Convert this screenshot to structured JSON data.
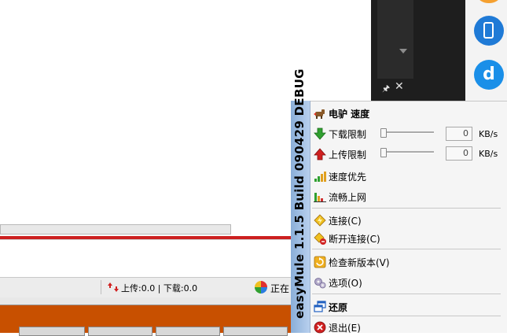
{
  "background": {
    "status_updown_text": "上传:0.0 | 下载:0.0",
    "status_now_text": "正在"
  },
  "banner": {
    "text": "easyMule 1.1.5 Build 090429 DEBUG"
  },
  "menu": {
    "items": [
      {
        "label": "电驴 速度",
        "icon": "donkey-icon",
        "bold": true
      },
      {
        "label": "下载限制",
        "icon": "arrow-down-icon",
        "value": "0",
        "unit": "KB/s"
      },
      {
        "label": "上传限制",
        "icon": "arrow-up-icon",
        "value": "0",
        "unit": "KB/s"
      },
      {
        "label": "速度优先",
        "icon": "signal-bars-icon"
      },
      {
        "label": "流畅上网",
        "icon": "bar-chart-icon"
      },
      {
        "label": "连接(C)",
        "icon": "connect-icon"
      },
      {
        "label": "断开连接(C)",
        "icon": "disconnect-icon"
      },
      {
        "label": "检查新版本(V)",
        "icon": "update-icon"
      },
      {
        "label": "选项(O)",
        "icon": "gears-icon"
      },
      {
        "label": "还原",
        "icon": "restore-window-icon",
        "bold": true
      },
      {
        "label": "退出(E)",
        "icon": "exit-icon"
      }
    ]
  },
  "colors": {
    "banner": "#a8c4e8",
    "taskbar": "#c85000",
    "accent_red": "#cc2020",
    "menu_bg": "#f5f5f5"
  }
}
